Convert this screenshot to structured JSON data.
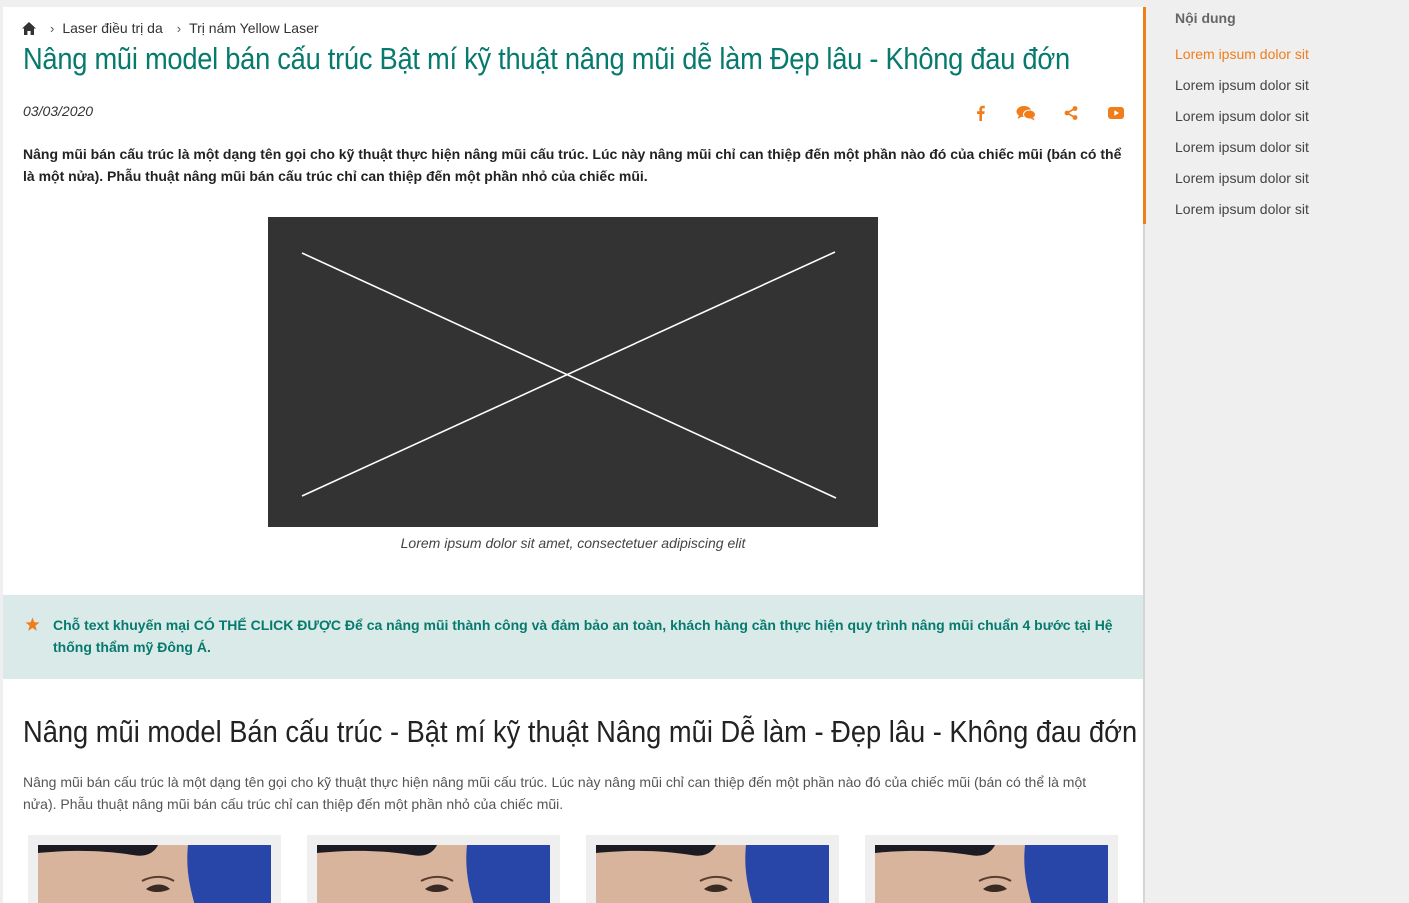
{
  "breadcrumb": {
    "items": [
      "Laser điều trị da",
      "Trị nám Yellow Laser"
    ]
  },
  "article": {
    "title": "Nâng mũi model bán cấu trúc Bật mí kỹ thuật nâng mũi dễ làm Đẹp lâu - Không đau đớn",
    "date": "03/03/2020",
    "share_icons": [
      "facebook-icon",
      "comment-icon",
      "share-icon",
      "youtube-icon"
    ],
    "lead": "Nâng mũi bán cấu trúc là một dạng tên gọi cho kỹ thuật thực hiện nâng mũi cấu trúc. Lúc này nâng mũi chỉ can thiệp đến một phần nào đó của chiếc mũi (bán có thể là một nửa). Phẫu thuật nâng mũi bán cấu trúc chỉ can thiệp đến một phần nhỏ của chiếc mũi.",
    "figure_caption": "Lorem ipsum dolor sit amet, consectetuer adipiscing elit",
    "promo": "Chỗ text khuyến mại CÓ THỂ CLICK ĐƯỢC Để ca nâng mũi thành công và đảm bảo an toàn, khách hàng cần thực hiện quy trình nâng mũi chuẩn 4 bước tại Hệ thống thẩm mỹ Đông Á.",
    "section_title": "Nâng mũi model Bán cấu trúc - Bật mí kỹ thuật Nâng mũi Dễ làm - Đẹp lâu - Không đau đớn",
    "section_body": "Nâng mũi bán cấu trúc là một dạng tên gọi cho kỹ thuật thực hiện nâng mũi cấu trúc. Lúc này nâng mũi chỉ can thiệp đến một phần nào đó của chiếc mũi (bán có thể là một nửa). Phẫu thuật nâng mũi bán cấu trúc chỉ can thiệp đến một phần nhỏ của chiếc mũi."
  },
  "toc": {
    "title": "Nội dung",
    "items": [
      "Lorem ipsum dolor sit",
      "Lorem ipsum dolor sit",
      "Lorem ipsum dolor sit",
      "Lorem ipsum dolor sit",
      "Lorem ipsum dolor sit",
      "Lorem ipsum dolor sit"
    ],
    "active_index": 0
  },
  "colors": {
    "accent": "#f07d1a",
    "title": "#077a6e",
    "promo_bg": "#d9eae8"
  }
}
